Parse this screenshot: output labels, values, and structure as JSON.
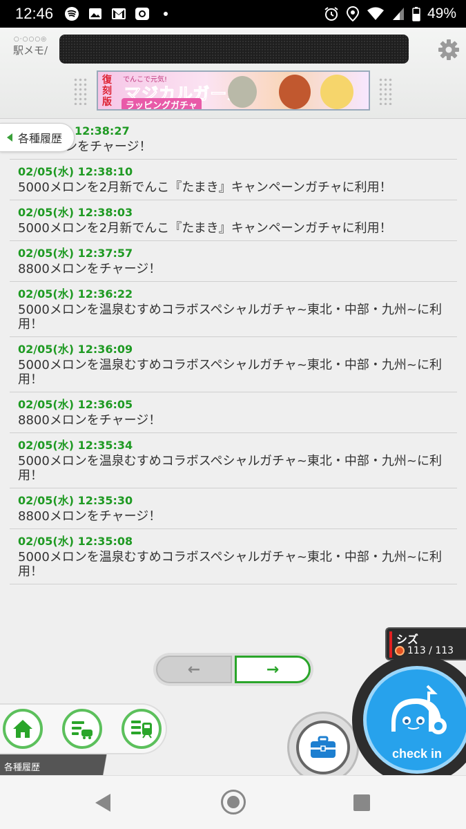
{
  "status_bar": {
    "time": "12:46",
    "battery_percent": "49%",
    "left_icons": [
      "spotify-icon",
      "image-icon",
      "gmail-icon",
      "camera-app-icon",
      "dot-icon"
    ],
    "right_icons": [
      "alarm-icon",
      "location-icon",
      "wifi-icon",
      "signal-icon",
      "battery-icon"
    ]
  },
  "header": {
    "logo_text": "駅メモ/",
    "logo_dots": "○·○○○◎",
    "banner": {
      "badge": "復刻版",
      "small": "でんこで元気!",
      "title": "マジカルガール",
      "subtitle": "ラッピングガチャ"
    }
  },
  "side_tab": {
    "label": "各種履歴"
  },
  "history": [
    {
      "date": "12:38:27",
      "message": "ロンをチャージ！"
    },
    {
      "date": "02/05(水) 12:38:10",
      "message": "5000メロンを2月新でんこ『たまき』キャンペーンガチャに利用！"
    },
    {
      "date": "02/05(水) 12:38:03",
      "message": "5000メロンを2月新でんこ『たまき』キャンペーンガチャに利用！"
    },
    {
      "date": "02/05(水) 12:37:57",
      "message": "8800メロンをチャージ！"
    },
    {
      "date": "02/05(水) 12:36:22",
      "message": "5000メロンを温泉むすめコラボスペシャルガチャ~東北・中部・九州~に利用！"
    },
    {
      "date": "02/05(水) 12:36:09",
      "message": "5000メロンを温泉むすめコラボスペシャルガチャ~東北・中部・九州~に利用！"
    },
    {
      "date": "02/05(水) 12:36:05",
      "message": "8800メロンをチャージ！"
    },
    {
      "date": "02/05(水) 12:35:34",
      "message": "5000メロンを温泉むすめコラボスペシャルガチャ~東北・中部・九州~に利用！"
    },
    {
      "date": "02/05(水) 12:35:30",
      "message": "8800メロンをチャージ！"
    },
    {
      "date": "02/05(水) 12:35:08",
      "message": "5000メロンを温泉むすめコラボスペシャルガチャ~東北・中部・九州~に利用！"
    }
  ],
  "pager": {
    "prev": "←",
    "next": "→"
  },
  "character": {
    "name": "シズ",
    "hp": "113 / 113"
  },
  "bottom_nav": {
    "section_label": "各種履歴",
    "buttons": [
      "home-icon",
      "history-menu-icon",
      "train-list-icon"
    ]
  },
  "checkin": {
    "label": "check in"
  },
  "colors": {
    "accent_green": "#1f9a23",
    "checkin_blue": "#27a2ec"
  }
}
